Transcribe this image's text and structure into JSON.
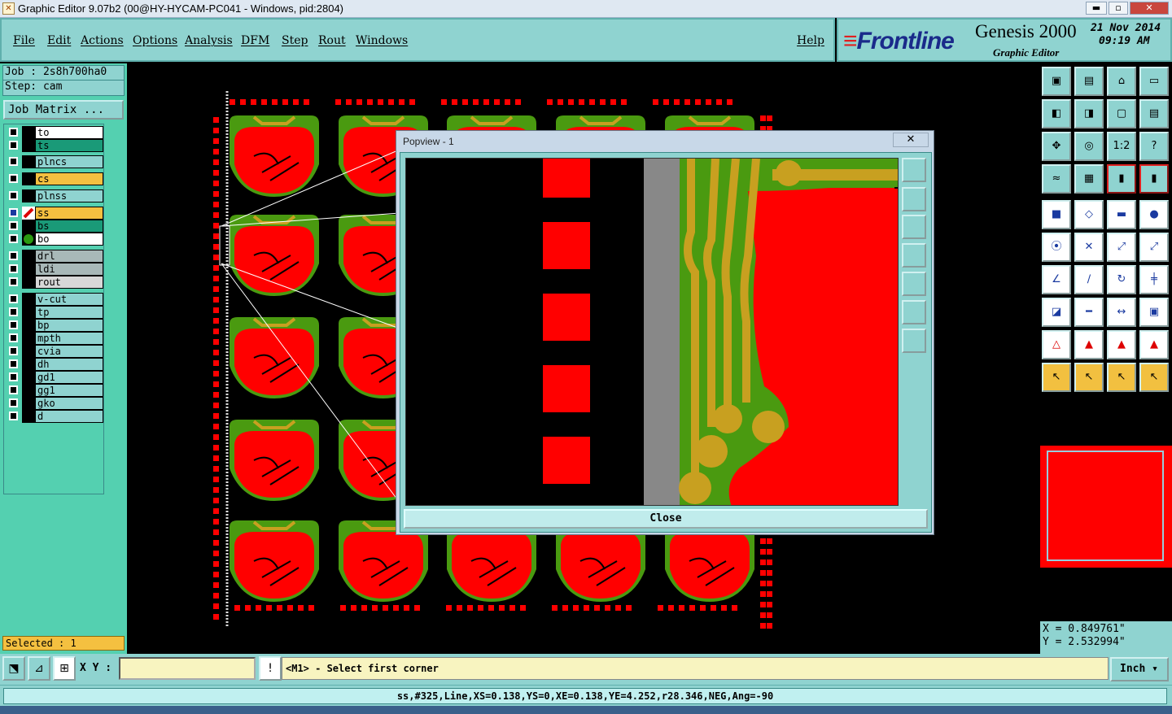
{
  "window": {
    "title": "Graphic Editor 9.07b2 (00@HY-HYCAM-PC041 - Windows, pid:2804)"
  },
  "menu": {
    "file": "File",
    "edit": "Edit",
    "actions": "Actions",
    "options": "Options",
    "analysis": "Analysis",
    "dfm": "DFM",
    "step": "Step",
    "rout": "Rout",
    "windows": "Windows",
    "help": "Help"
  },
  "brand": {
    "logo": "Frontline",
    "product": "Genesis 2000",
    "subtitle": "Graphic Editor",
    "date": "21 Nov 2014",
    "time": "09:19 AM"
  },
  "job": {
    "job_line": "Job : 2s8h700ha0",
    "step_line": "Step: cam",
    "matrix_button": "Job Matrix ..."
  },
  "layers": [
    {
      "name": "to",
      "color": "#ffffff"
    },
    {
      "name": "ts",
      "color": "#1a9a78"
    },
    {
      "name": "plncs",
      "color": "#8fd3d0"
    },
    {
      "name": "cs",
      "color": "#f4c040"
    },
    {
      "name": "plnss",
      "color": "#8fd3d0"
    },
    {
      "name": "ss",
      "color": "#f4c040"
    },
    {
      "name": "bs",
      "color": "#1a9a78"
    },
    {
      "name": "bo",
      "color": "#ffffff"
    },
    {
      "name": "drl",
      "color": "#a8b8b8"
    },
    {
      "name": "ldi",
      "color": "#a8b8b8"
    },
    {
      "name": "rout",
      "color": "#d8d8d8"
    },
    {
      "name": "v-cut",
      "color": "#8fd3d0"
    },
    {
      "name": "tp",
      "color": "#8fd3d0"
    },
    {
      "name": "bp",
      "color": "#8fd3d0"
    },
    {
      "name": "mpth",
      "color": "#8fd3d0"
    },
    {
      "name": "cvia",
      "color": "#8fd3d0"
    },
    {
      "name": "dh",
      "color": "#8fd3d0"
    },
    {
      "name": "gd1",
      "color": "#8fd3d0"
    },
    {
      "name": "gg1",
      "color": "#8fd3d0"
    },
    {
      "name": "gko",
      "color": "#8fd3d0"
    },
    {
      "name": "d",
      "color": "#8fd3d0"
    }
  ],
  "selected_text": "Selected : 1",
  "popup": {
    "title": "Popview - 1",
    "close_x": "✕",
    "close_label": "Close"
  },
  "tools": {
    "ratio_label": "1:2",
    "help_label": "?"
  },
  "coords": {
    "x": "X = 0.849761\"",
    "y": "Y = 2.532994\""
  },
  "bottom": {
    "xy_label": "X Y :",
    "xy_value": "",
    "prompt": "<M1> - Select first corner",
    "unit": "Inch",
    "warn": "!"
  },
  "status": "ss,#325,Line,XS=0.138,YS=0,XE=0.138,YE=4.252,r28.346,NEG,Ang=-90",
  "colors": {
    "panel": "#8fd3d0",
    "left_panel": "#54d0b0",
    "copper": "#ff0000",
    "mask": "#4a9a10",
    "silk": "#c8a020"
  }
}
